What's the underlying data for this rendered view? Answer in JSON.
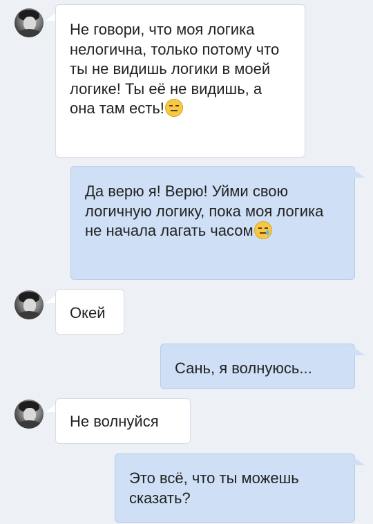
{
  "messages": [
    {
      "sender": "incoming",
      "text": "Не говори, что моя логика нелогична, только потому что ты не видишь логики в моей логике! Ты её не видишь, а она там есть!",
      "emoji": "expressionless-face-emoji"
    },
    {
      "sender": "outgoing",
      "text": "Да верю я! Верю! Уйми свою логичную логику, пока моя логика не начала лагать часом",
      "emoji": "sleepy-face-emoji"
    },
    {
      "sender": "incoming",
      "text": "Окей"
    },
    {
      "sender": "outgoing",
      "text": "Сань, я волнуюсь..."
    },
    {
      "sender": "incoming",
      "text": "Не волнуйся"
    },
    {
      "sender": "outgoing",
      "text": "Это всё, что ты можешь сказать?"
    }
  ],
  "colors": {
    "background": "#edf0f5",
    "incoming_bubble": "#ffffff",
    "outgoing_bubble": "#cfe0f6",
    "text": "#222222"
  }
}
